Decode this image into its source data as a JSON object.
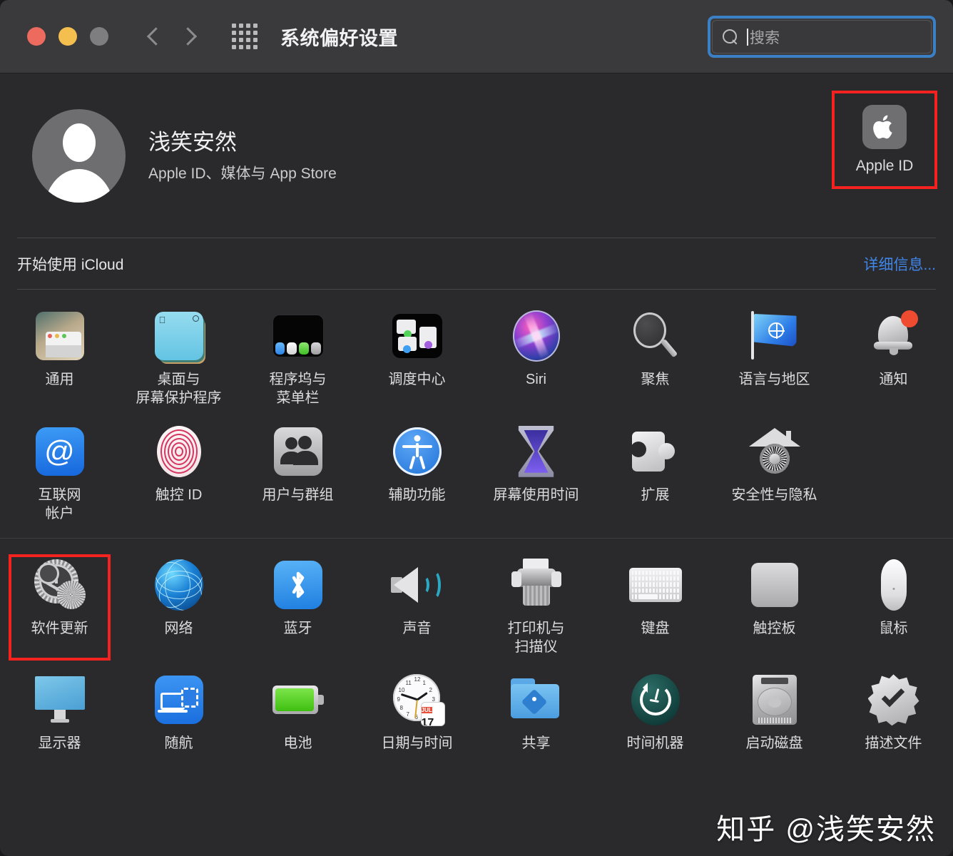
{
  "titlebar": {
    "title": "系统偏好设置",
    "back_icon": "chevron-left-icon",
    "forward_icon": "chevron-right-icon",
    "grid_icon": "grid-view-icon",
    "search": {
      "placeholder": "搜索",
      "value": "",
      "icon": "search-icon"
    },
    "traffic_lights": [
      "close",
      "minimize",
      "zoom"
    ]
  },
  "account": {
    "name": "浅笑安然",
    "subtitle": "Apple ID、媒体与 App Store",
    "avatar_icon": "user-avatar-icon",
    "appleid": {
      "label": "Apple ID",
      "icon": "apple-logo-icon",
      "highlighted": true
    }
  },
  "icloud": {
    "text": "开始使用 iCloud",
    "link": "详细信息..."
  },
  "sections": [
    {
      "id": "personal",
      "rows": [
        [
          {
            "label": "通用",
            "icon": "general-icon"
          },
          {
            "label": "桌面与\n屏幕保护程序",
            "icon": "desktop-screensaver-icon"
          },
          {
            "label": "程序坞与\n菜单栏",
            "icon": "dock-menubar-icon"
          },
          {
            "label": "调度中心",
            "icon": "mission-control-icon"
          },
          {
            "label": "Siri",
            "icon": "siri-icon"
          },
          {
            "label": "聚焦",
            "icon": "spotlight-icon"
          },
          {
            "label": "语言与地区",
            "icon": "language-region-icon"
          },
          {
            "label": "通知",
            "icon": "notifications-icon",
            "badge": true
          }
        ],
        [
          {
            "label": "互联网\n帐户",
            "icon": "internet-accounts-icon"
          },
          {
            "label": "触控 ID",
            "icon": "touch-id-icon"
          },
          {
            "label": "用户与群组",
            "icon": "users-groups-icon"
          },
          {
            "label": "辅助功能",
            "icon": "accessibility-icon"
          },
          {
            "label": "屏幕使用时间",
            "icon": "screen-time-icon"
          },
          {
            "label": "扩展",
            "icon": "extensions-icon"
          },
          {
            "label": "安全性与隐私",
            "icon": "security-privacy-icon"
          }
        ]
      ]
    },
    {
      "id": "hardware",
      "rows": [
        [
          {
            "label": "软件更新",
            "icon": "software-update-icon",
            "highlighted": true
          },
          {
            "label": "网络",
            "icon": "network-icon"
          },
          {
            "label": "蓝牙",
            "icon": "bluetooth-icon"
          },
          {
            "label": "声音",
            "icon": "sound-icon"
          },
          {
            "label": "打印机与\n扫描仪",
            "icon": "printers-scanners-icon"
          },
          {
            "label": "键盘",
            "icon": "keyboard-icon"
          },
          {
            "label": "触控板",
            "icon": "trackpad-icon"
          },
          {
            "label": "鼠标",
            "icon": "mouse-icon"
          }
        ],
        [
          {
            "label": "显示器",
            "icon": "displays-icon"
          },
          {
            "label": "随航",
            "icon": "sidecar-icon"
          },
          {
            "label": "电池",
            "icon": "battery-icon"
          },
          {
            "label": "日期与时间",
            "icon": "date-time-icon",
            "month": "JUL",
            "day": "17"
          },
          {
            "label": "共享",
            "icon": "sharing-icon"
          },
          {
            "label": "时间机器",
            "icon": "time-machine-icon"
          },
          {
            "label": "启动磁盘",
            "icon": "startup-disk-icon"
          },
          {
            "label": "描述文件",
            "icon": "profiles-icon"
          }
        ]
      ]
    }
  ],
  "watermark": "知乎 @浅笑安然",
  "colors": {
    "window_bg": "#2a2a2c",
    "titlebar_bg": "#3a3a3c",
    "accent_link": "#3f86e8",
    "focus_ring": "#3b7fc4",
    "annotation_box": "#f5231f",
    "badge_red": "#ef4b31"
  }
}
